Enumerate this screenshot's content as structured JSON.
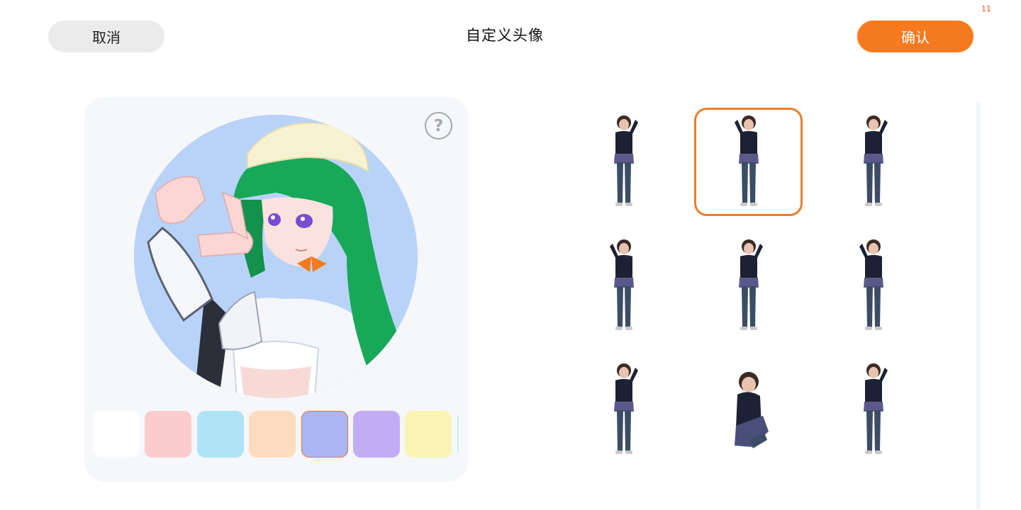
{
  "status": {
    "text": "11"
  },
  "header": {
    "cancel_label": "取消",
    "title": "自定义头像",
    "confirm_label": "确认"
  },
  "preview": {
    "help_symbol": "?",
    "circle_color": "#b9d3f8"
  },
  "colors": {
    "accent": "#f57a1f",
    "selected_border": "#ec7d2b"
  },
  "swatches": [
    {
      "color": "#ffffff",
      "selected": false
    },
    {
      "color": "#fbcccd",
      "selected": false
    },
    {
      "color": "#aee4f5",
      "selected": false
    },
    {
      "color": "#fedcc0",
      "selected": false
    },
    {
      "color": "#aab6f4",
      "selected": true
    },
    {
      "color": "#c2adf4",
      "selected": false
    },
    {
      "color": "#faf4b4",
      "selected": false
    },
    {
      "color": "#bdf3e6",
      "selected": false
    }
  ],
  "poses": [
    {
      "name": "pose-1",
      "selected": false
    },
    {
      "name": "pose-2",
      "selected": true
    },
    {
      "name": "pose-3",
      "selected": false
    },
    {
      "name": "pose-4",
      "selected": false
    },
    {
      "name": "pose-5",
      "selected": false
    },
    {
      "name": "pose-6",
      "selected": false
    },
    {
      "name": "pose-7",
      "selected": false
    },
    {
      "name": "pose-8",
      "selected": false
    },
    {
      "name": "pose-9",
      "selected": false
    }
  ]
}
